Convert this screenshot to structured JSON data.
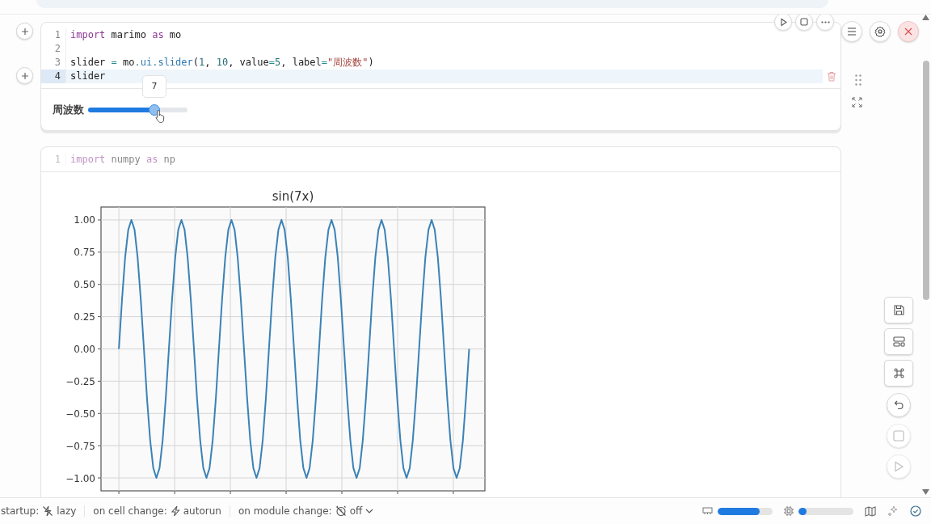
{
  "cells": [
    {
      "lines": [
        {
          "number": "1",
          "selected": false,
          "tokens": [
            {
              "text": "import",
              "kind": "keyword"
            },
            {
              "text": " marimo ",
              "kind": "plain"
            },
            {
              "text": "as",
              "kind": "keyword"
            },
            {
              "text": " mo",
              "kind": "plain"
            }
          ]
        },
        {
          "number": "2",
          "selected": false
        },
        {
          "number": "3",
          "selected": false,
          "tokens": [
            {
              "text": "slider ",
              "kind": "plain"
            },
            {
              "text": "=",
              "kind": "operator"
            },
            {
              "text": " mo",
              "kind": "plain"
            },
            {
              "text": ".",
              "kind": "operator"
            },
            {
              "text": "ui",
              "kind": "attribute"
            },
            {
              "text": ".",
              "kind": "operator"
            },
            {
              "text": "slider",
              "kind": "attribute"
            },
            {
              "text": "(",
              "kind": "plain"
            },
            {
              "text": "1",
              "kind": "number"
            },
            {
              "text": ", ",
              "kind": "plain"
            },
            {
              "text": "10",
              "kind": "number"
            },
            {
              "text": ", value",
              "kind": "plain"
            },
            {
              "text": "=",
              "kind": "operator"
            },
            {
              "text": "5",
              "kind": "number"
            },
            {
              "text": ", label",
              "kind": "plain"
            },
            {
              "text": "=",
              "kind": "operator"
            },
            {
              "text": "\"周波数\"",
              "kind": "string"
            },
            {
              "text": ")",
              "kind": "plain"
            }
          ]
        },
        {
          "number": "4",
          "selected": true,
          "tokens": [
            {
              "text": "slider",
              "kind": "plain"
            }
          ]
        }
      ],
      "faded": false,
      "output": {
        "kind": "slider",
        "label": "周波数",
        "level": 0.667,
        "tooltip": "7"
      }
    },
    {
      "lines": [
        {
          "number": "1",
          "selected": false,
          "tokens": [
            {
              "text": "import",
              "kind": "keyword"
            },
            {
              "text": " numpy ",
              "kind": "plain"
            },
            {
              "text": "as",
              "kind": "keyword"
            },
            {
              "text": " np",
              "kind": "plain"
            }
          ]
        }
      ],
      "faded": true,
      "output": {
        "kind": "chart",
        "chart_data": {
          "type": "line",
          "title": "sin(7x)",
          "grid": true,
          "ylim": [
            -1.1,
            1.1
          ],
          "yticks": [
            {
              "value": 1,
              "label": "1.00"
            },
            {
              "value": 0.75,
              "label": "0.75"
            },
            {
              "value": 0.5,
              "label": "0.50"
            },
            {
              "value": 0.25,
              "label": "0.25"
            },
            {
              "value": 0,
              "label": "0.00"
            },
            {
              "value": -0.25,
              "label": "−0.25"
            },
            {
              "value": -0.5,
              "label": "−0.50"
            },
            {
              "value": -0.75,
              "label": "−0.75"
            },
            {
              "value": -1,
              "label": "−1.00"
            }
          ],
          "categories": [
            null,
            null,
            null,
            null,
            null,
            null,
            null,
            null,
            null,
            null,
            null,
            null,
            null,
            null,
            null,
            null,
            null,
            null,
            null,
            null,
            null,
            null,
            null,
            null,
            null,
            null,
            null,
            null,
            null,
            null,
            null,
            null,
            null,
            null,
            null,
            null,
            null,
            null,
            null,
            null,
            null,
            null,
            null,
            null,
            null,
            null,
            null,
            null,
            null,
            null,
            null,
            null,
            null,
            null,
            null,
            null,
            null,
            null,
            null,
            null,
            null,
            null,
            null,
            null,
            null,
            null,
            null,
            null,
            null,
            null,
            null,
            null,
            null,
            null,
            null,
            null,
            null,
            null,
            null,
            null,
            null,
            null,
            null,
            null,
            null,
            null,
            null,
            null,
            null,
            null,
            null,
            null,
            null,
            null,
            null,
            null,
            null,
            null,
            null,
            null,
            null,
            null,
            null,
            null,
            null,
            null,
            null,
            null,
            null,
            null,
            null,
            null,
            null
          ],
          "series": [
            {
              "color": "#3b82b6",
              "values": [
                0,
                0.383,
                0.707,
                0.924,
                1,
                0.924,
                0.707,
                0.383,
                0,
                -0.383,
                -0.707,
                -0.924,
                -1,
                -0.924,
                -0.707,
                -0.383,
                0,
                0.383,
                0.707,
                0.924,
                1,
                0.924,
                0.707,
                0.383,
                0,
                -0.383,
                -0.707,
                -0.924,
                -1,
                -0.924,
                -0.707,
                -0.383,
                0,
                0.383,
                0.707,
                0.924,
                1,
                0.924,
                0.707,
                0.383,
                0,
                -0.383,
                -0.707,
                -0.924,
                -1,
                -0.924,
                -0.707,
                -0.383,
                0,
                0.383,
                0.707,
                0.924,
                1,
                0.924,
                0.707,
                0.383,
                0,
                -0.383,
                -0.707,
                -0.924,
                -1,
                -0.924,
                -0.707,
                -0.383,
                0,
                0.383,
                0.707,
                0.924,
                1,
                0.924,
                0.707,
                0.383,
                0,
                -0.383,
                -0.707,
                -0.924,
                -1,
                -0.924,
                -0.707,
                -0.383,
                0,
                0.383,
                0.707,
                0.924,
                1,
                0.924,
                0.707,
                0.383,
                0,
                -0.383,
                -0.707,
                -0.924,
                -1,
                -0.924,
                -0.707,
                -0.383,
                0,
                0.383,
                0.707,
                0.924,
                1,
                0.924,
                0.707,
                0.383,
                0,
                -0.383,
                -0.707,
                -0.924,
                -1,
                -0.924,
                -0.707,
                -0.383,
                0
              ]
            }
          ]
        }
      }
    }
  ],
  "status_bar": {
    "items": [
      {
        "kind": "startup",
        "label": "startup:",
        "value": "lazy"
      },
      {
        "kind": "cell",
        "label": "on cell change:",
        "value": "autorun"
      },
      {
        "kind": "module",
        "label": "on module change:",
        "value": "off"
      }
    ],
    "meters": [
      {
        "kind": "memory",
        "level": 0.76
      },
      {
        "kind": "cpu",
        "level": 0.15
      }
    ]
  }
}
